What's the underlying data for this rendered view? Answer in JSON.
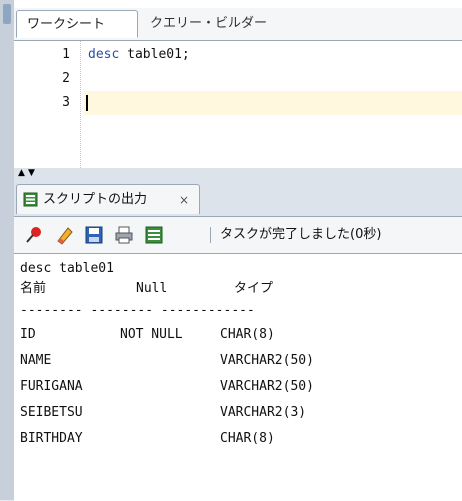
{
  "worksheet": {
    "tabs": [
      {
        "label": "ワークシート",
        "active": true
      },
      {
        "label": "クエリー・ビルダー",
        "active": false
      }
    ],
    "lines": [
      {
        "num": "1",
        "keyword": "desc",
        "rest": " table01;"
      },
      {
        "num": "2",
        "keyword": "",
        "rest": ""
      },
      {
        "num": "3",
        "keyword": "",
        "rest": ""
      }
    ]
  },
  "output_panel": {
    "tab_label": "スクリプトの出力",
    "close_label": "×",
    "toolbar": {
      "icons": [
        "pin-icon",
        "eraser-icon",
        "save-icon",
        "print-icon",
        "script-icon"
      ],
      "status": "タスクが完了しました(0秒)"
    },
    "command": "desc table01",
    "headers": {
      "name": "名前",
      "null": "Null",
      "type": "タイプ"
    },
    "separator": "-------- -------- ------------",
    "rows": [
      {
        "name": "ID",
        "null": "NOT NULL",
        "type": "CHAR(8)"
      },
      {
        "name": "NAME",
        "null": "",
        "type": "VARCHAR2(50)"
      },
      {
        "name": "FURIGANA",
        "null": "",
        "type": "VARCHAR2(50)"
      },
      {
        "name": "SEIBETSU",
        "null": "",
        "type": "VARCHAR2(3)"
      },
      {
        "name": "BIRTHDAY",
        "null": "",
        "type": "CHAR(8)"
      }
    ]
  },
  "colors": {
    "keyword": "#2a4fa8",
    "current_line": "#fff8df",
    "panel_bg": "#dde3ea"
  }
}
